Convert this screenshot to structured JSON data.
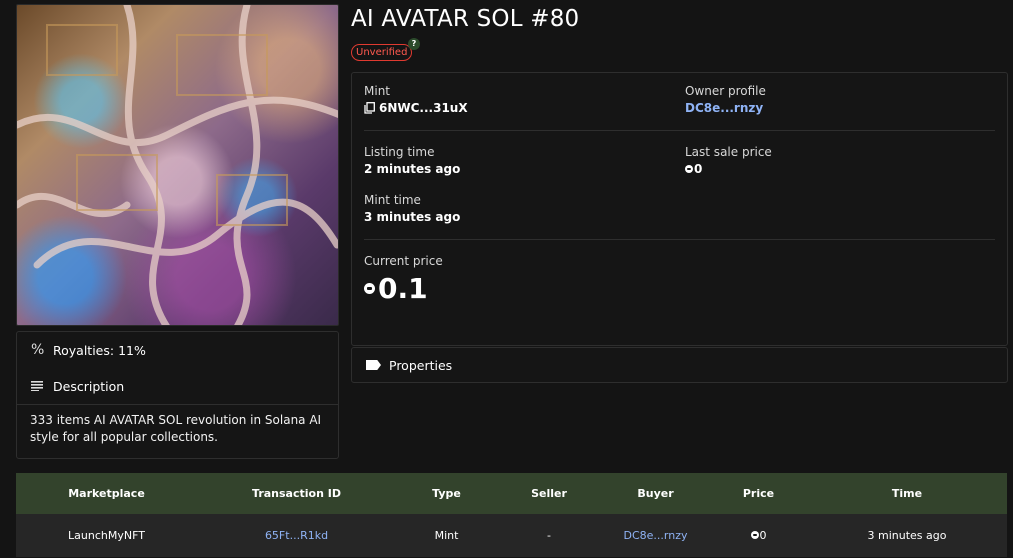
{
  "nft": {
    "title": "AI AVATAR SOL #80",
    "status_badge": "Unverified",
    "status_help_icon": "?"
  },
  "sidebar": {
    "royalties": "Royalties: 11%",
    "description_label": "Description",
    "description_text": "333 items AI AVATAR SOL revolution in Solana AI style for all popular collections."
  },
  "details": {
    "mint_label": "Mint",
    "mint_value": "6NWC...31uX",
    "owner_label": "Owner profile",
    "owner_value": "DC8e...rnzy",
    "listing_time_label": "Listing time",
    "listing_time_value": "2 minutes ago",
    "last_sale_label": "Last sale price",
    "last_sale_value": "0",
    "mint_time_label": "Mint time",
    "mint_time_value": "3 minutes ago",
    "current_price_label": "Current price",
    "current_price_value": "0.1"
  },
  "properties_label": "Properties",
  "transactions": {
    "headers": [
      "Marketplace",
      "Transaction ID",
      "Type",
      "Seller",
      "Buyer",
      "Price",
      "Time"
    ],
    "rows": [
      {
        "marketplace": "LaunchMyNFT",
        "transaction_id": "65Ft...R1kd",
        "type": "Mint",
        "seller": "-",
        "buyer": "DC8e...rnzy",
        "price": "0",
        "time": "3 minutes ago"
      }
    ]
  },
  "colors": {
    "accent_link": "#8fb3f5",
    "unverified_red": "#e03a30",
    "table_header_green": "#33432c"
  },
  "icons": [
    "percent-icon",
    "list-icon",
    "copy-icon",
    "sol-coin-icon",
    "tag-icon",
    "help-icon"
  ]
}
